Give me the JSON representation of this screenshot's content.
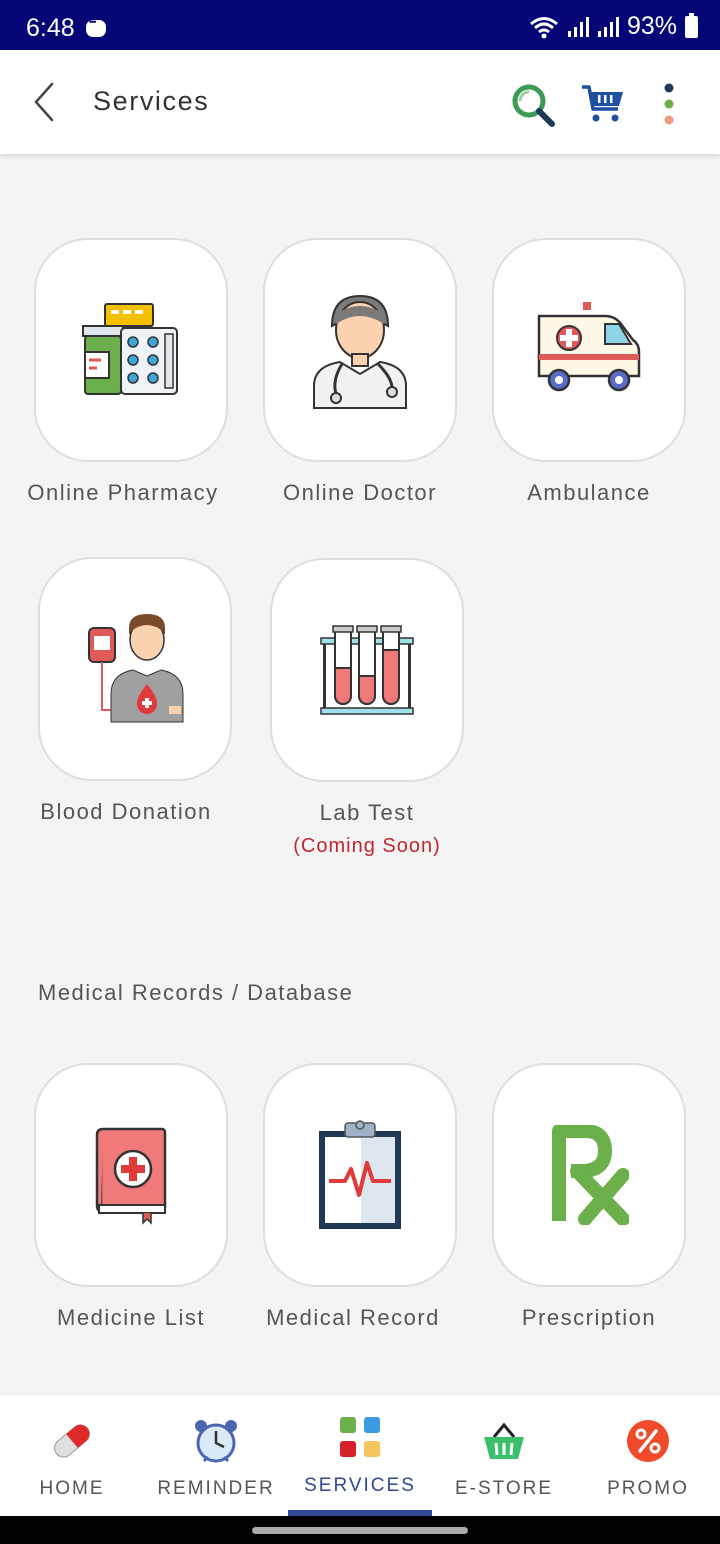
{
  "status_bar": {
    "time": "6:48",
    "battery": "93%"
  },
  "header": {
    "title": "Services"
  },
  "services": [
    {
      "label": "Online Pharmacy"
    },
    {
      "label": "Online Doctor"
    },
    {
      "label": "Ambulance"
    },
    {
      "label": "Blood Donation"
    },
    {
      "label": "Lab Test",
      "note": "(Coming Soon)"
    }
  ],
  "records_section": {
    "title": "Medical Records / Database",
    "items": [
      {
        "label": "Medicine List"
      },
      {
        "label": "Medical Record"
      },
      {
        "label": "Prescription"
      }
    ]
  },
  "bottom_nav": {
    "items": [
      {
        "label": "HOME"
      },
      {
        "label": "REMINDER"
      },
      {
        "label": "SERVICES",
        "active": true
      },
      {
        "label": "E-STORE"
      },
      {
        "label": "PROMO"
      }
    ]
  },
  "colors": {
    "status_bar": "#050575",
    "accent": "#2f4a94",
    "coming_soon": "#c0282f"
  }
}
